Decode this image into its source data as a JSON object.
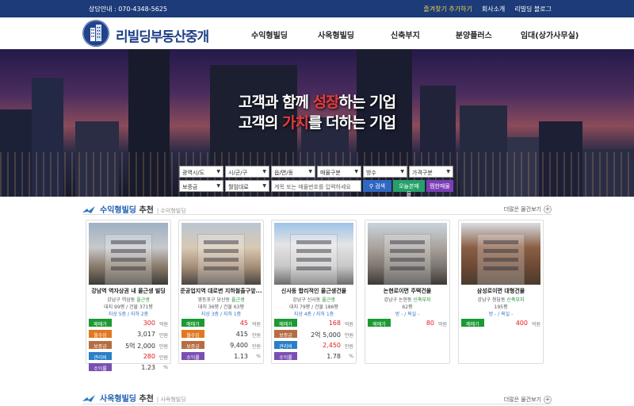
{
  "topbar": {
    "phone": "상담안내 : 070-4348-5625",
    "links": [
      "즐겨찾기 추가하기",
      "회사소개",
      "리빌딩 블로그"
    ]
  },
  "brand": {
    "name": "리빌딩부동산중개"
  },
  "nav": [
    "수익형빌딩",
    "사옥형빌딩",
    "신축부지",
    "분양플러스",
    "임대(상가사무실)"
  ],
  "hero": {
    "line1_a": "고객과 함께 ",
    "line1_b": "성장",
    "line1_c": "하는 기업",
    "line2_a": "고객의 ",
    "line2_b": "가치",
    "line2_c": "를 더하는 기업"
  },
  "search": {
    "row1": [
      "광역시/도",
      "시/군/구",
      "읍/면/동",
      "매물구분",
      "방수",
      "가격구분"
    ],
    "row2": [
      "보증금",
      "월임대료"
    ],
    "placeholder": "계목 또는 매물번호를 입력하세요",
    "buttons": [
      "검색",
      "오늘본매물",
      "찜한매물"
    ]
  },
  "sections": [
    {
      "title_a": "수익형빌딩",
      "title_b": " 추천",
      "sub": "| 수익형빌딩",
      "more": "더많은 물건보기"
    },
    {
      "title_a": "사옥형빌딩",
      "title_b": " 추천",
      "sub": "| 사옥형빌딩",
      "more": "더많은 물건보기"
    }
  ],
  "colors": {
    "navy": "#1c3b78",
    "green": "#1b9a34",
    "orange": "#e17822",
    "brown": "#b76d42",
    "blue": "#2a7fc8",
    "purple": "#7a4fb2",
    "red": "#e11c1c"
  },
  "cards": [
    {
      "title": "강남역 역자상권 내 올근생 빌딩",
      "addr_a": "강남구 역삼동 ",
      "addr_b": "올근생",
      "size": "대지 99평 / 건물 371평",
      "floor": "지상 5층 / 지하 2층",
      "rows": [
        {
          "label": "매매가",
          "value": "300",
          "unit": "억원",
          "color": "green",
          "red": true
        },
        {
          "label": "월수입",
          "value": "3,017",
          "unit": "만원",
          "color": "orange",
          "red": false
        },
        {
          "label": "보증금",
          "value": "5억 2,000",
          "unit": "만원",
          "color": "brown",
          "red": false
        },
        {
          "label": "관리비",
          "value": "280",
          "unit": "만원",
          "color": "blue",
          "red": true
        },
        {
          "label": "수익률",
          "value": "1.23",
          "unit": "%",
          "color": "purple",
          "red": false
        }
      ]
    },
    {
      "title": "준공업지역 대로변 지하철출구앞...",
      "addr_a": "영등포구 당산동 ",
      "addr_b": "올근생",
      "size": "대지 36평 / 건물 63평",
      "floor": "지상 3층 / 지하 1층",
      "rows": [
        {
          "label": "매매가",
          "value": "45",
          "unit": "억원",
          "color": "green",
          "red": true
        },
        {
          "label": "월수입",
          "value": "415",
          "unit": "만원",
          "color": "orange",
          "red": false
        },
        {
          "label": "보증금",
          "value": "9,400",
          "unit": "만원",
          "color": "brown",
          "red": false
        },
        {
          "label": "수익률",
          "value": "1.13",
          "unit": "%",
          "color": "purple",
          "red": false
        }
      ]
    },
    {
      "title": "신사동 합리적인 올근생건물",
      "addr_a": "강남구 신사동 ",
      "addr_b": "올근생",
      "size": "대지 79평 / 건물 186평",
      "floor": "지상 4층 / 지하 1층",
      "rows": [
        {
          "label": "매매가",
          "value": "168",
          "unit": "억원",
          "color": "green",
          "red": true
        },
        {
          "label": "보증금",
          "value": "2억 5,000",
          "unit": "만원",
          "color": "brown",
          "red": false
        },
        {
          "label": "관리비",
          "value": "2,450",
          "unit": "만원",
          "color": "blue",
          "red": true
        },
        {
          "label": "수익률",
          "value": "1.78",
          "unit": "%",
          "color": "purple",
          "red": false
        }
      ]
    },
    {
      "title": "논현로이면 주택건물",
      "addr_a": "강남구 논현동 ",
      "addr_b": "신축부지",
      "size": "62평",
      "floor": "",
      "rows": [
        {
          "label": "매매가",
          "value": "80",
          "unit": "억원",
          "color": "green",
          "red": true
        }
      ]
    },
    {
      "title": "삼성로이면 대형건물",
      "addr_a": "강남구 청담동 ",
      "addr_b": "신축부지",
      "size": "195평",
      "floor": "",
      "rows": [
        {
          "label": "매매가",
          "value": "400",
          "unit": "억원",
          "color": "green",
          "red": true
        }
      ]
    }
  ],
  "card_extra": "방 - / 욕실 -"
}
